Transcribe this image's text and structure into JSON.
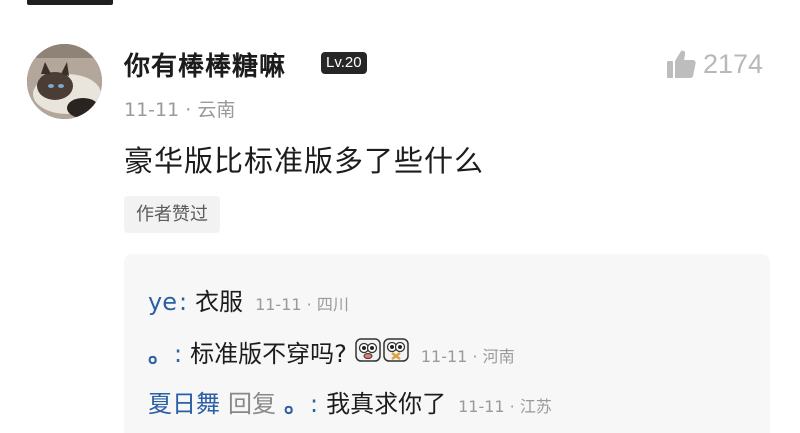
{
  "comment": {
    "username": "你有棒棒糖嘛",
    "level": "Lv.20",
    "like_count": "2174",
    "meta": "11-11 · 云南",
    "content": "豪华版比标准版多了些什么",
    "author_liked": "作者赞过",
    "icons": {
      "like": "thumbs-up-icon",
      "avatar": "siamese-cat-avatar"
    }
  },
  "replies": [
    {
      "name": "ye",
      "separator": ":",
      "text": "衣服",
      "time": "11-11 · 四川"
    },
    {
      "name": "。",
      "separator": ":",
      "text": "标准版不穿吗?",
      "time": "11-11 · 河南",
      "emojis": [
        "eyes-face-emoji",
        "eyes-face-emoji"
      ]
    },
    {
      "name": "夏日舞",
      "reply_word": "回复",
      "target": "。",
      "separator": ":",
      "text": "我真求你了",
      "time": "11-11 · 江苏"
    }
  ]
}
